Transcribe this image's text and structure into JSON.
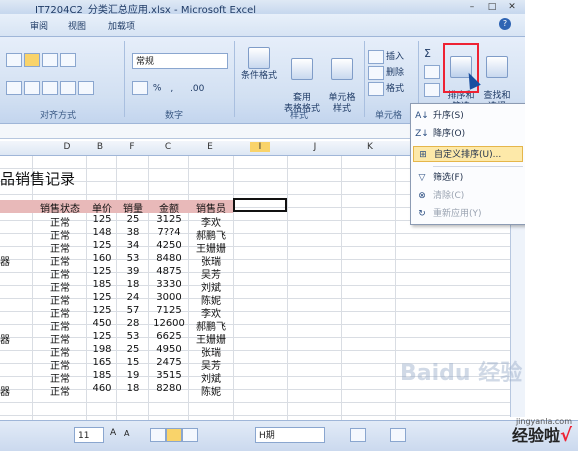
{
  "window": {
    "title": "IT7204C2_分类汇总应用.xlsx - Microsoft Excel",
    "controls": [
      "–",
      "□",
      "✕"
    ]
  },
  "tabs": [
    "审阅",
    "视图",
    "加载项"
  ],
  "ribbon": {
    "font_group": {
      "label": "对齐方式"
    },
    "number_group": {
      "label": "数字",
      "format": "常规",
      "percent": "%",
      "comma": ",",
      "decimals": ".00"
    },
    "styles_group": {
      "label": "样式",
      "conditional": "条件格式",
      "table": "套用\n表格格式",
      "cell": "单元格\n样式"
    },
    "cells_group": {
      "label": "单元格",
      "insert": "插入",
      "delete": "删除",
      "format": "格式"
    },
    "editing_group": {
      "sigma": "Σ",
      "sort_filter": "排序和\n筛选",
      "find_select": "查找和\n选择"
    }
  },
  "columns": [
    "D",
    "B",
    "F",
    "C",
    "E",
    "I",
    "J",
    "K"
  ],
  "sheet": {
    "title": "品销售记录",
    "headers": [
      "销售状态",
      "单价",
      "销量",
      "金额",
      "销售员"
    ],
    "rows": [
      [
        "正常",
        "125",
        "25",
        "3125",
        "李欢"
      ],
      [
        "正常",
        "148",
        "38",
        "7??4",
        "郝鹏飞"
      ],
      [
        "正常",
        "125",
        "34",
        "4250",
        "王姗姗"
      ],
      [
        "正常",
        "160",
        "53",
        "8480",
        "张瑞"
      ],
      [
        "正常",
        "125",
        "39",
        "4875",
        "吴芳"
      ],
      [
        "正常",
        "185",
        "18",
        "3330",
        "刘斌"
      ],
      [
        "正常",
        "125",
        "24",
        "3000",
        "陈妮"
      ],
      [
        "正常",
        "125",
        "57",
        "7125",
        "李欢"
      ],
      [
        "正常",
        "450",
        "28",
        "12600",
        "郝鹏飞"
      ],
      [
        "正常",
        "125",
        "53",
        "6625",
        "王姗姗"
      ],
      [
        "正常",
        "198",
        "25",
        "4950",
        "张瑞"
      ],
      [
        "正常",
        "165",
        "15",
        "2475",
        "吴芳"
      ],
      [
        "正常",
        "185",
        "19",
        "3515",
        "刘斌"
      ],
      [
        "正常",
        "460",
        "18",
        "8280",
        "陈妮"
      ]
    ],
    "left_fragments": [
      "",
      "",
      "",
      "器",
      "",
      "",
      "",
      "",
      "",
      "器",
      "",
      "",
      "",
      "器"
    ]
  },
  "menu": {
    "items": [
      {
        "icon": "A↓",
        "label": "升序(S)"
      },
      {
        "icon": "Z↓",
        "label": "降序(O)"
      },
      {
        "icon": "⊞",
        "label": "自定义排序(U)..."
      },
      {
        "icon": "▽",
        "label": "筛选(F)"
      },
      {
        "icon": "⊗",
        "label": "清除(C)"
      },
      {
        "icon": "↻",
        "label": "重新应用(Y)"
      }
    ]
  },
  "bottom": {
    "font_size": "11",
    "grow": "A",
    "shrink": "A",
    "combo": "H期"
  },
  "watermark": {
    "main": "经验啦",
    "check": "√",
    "sub": "jingyanla.com"
  },
  "baidu": "Baidu 经验"
}
